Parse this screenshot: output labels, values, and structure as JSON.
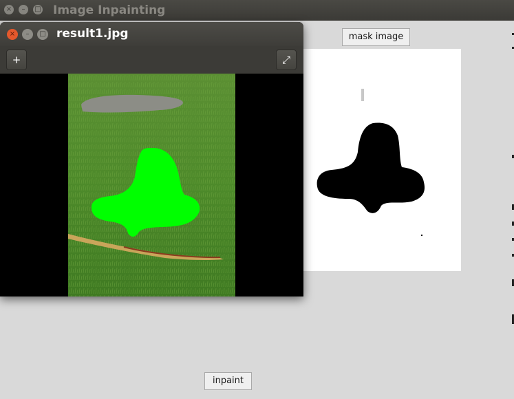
{
  "main_window": {
    "title": "Image Inpainting",
    "buttons": {
      "close": "×",
      "minimize": "–",
      "maximize": "□"
    }
  },
  "mask_button": {
    "label": "mask image"
  },
  "inpaint_button": {
    "label": "inpaint"
  },
  "image_window": {
    "title": "result1.jpg",
    "buttons": {
      "close": "×",
      "minimize": "–",
      "maximize": "□"
    },
    "toolbar": {
      "zoom_in_icon": "+",
      "fullscreen_icon": "⤢"
    }
  },
  "colors": {
    "background": "#d9d9d9",
    "titlebar": "#3b3a36",
    "close_orange": "#e4582c",
    "mask_highlight": "#00ff00",
    "grass": "#4f8a2a"
  }
}
